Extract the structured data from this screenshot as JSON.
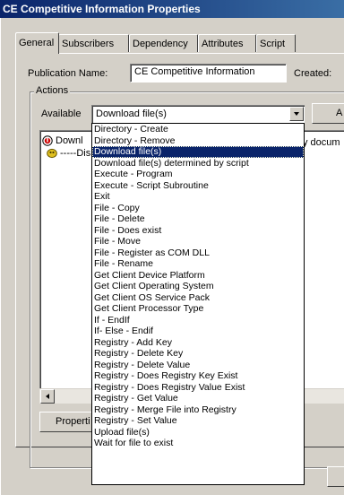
{
  "window": {
    "title": "CE Competitive Information Properties"
  },
  "tabs": [
    {
      "label": "General",
      "active": true
    },
    {
      "label": "Subscribers",
      "active": false
    },
    {
      "label": "Dependency",
      "active": false
    },
    {
      "label": "Attributes",
      "active": false
    },
    {
      "label": "Script",
      "active": false
    }
  ],
  "general": {
    "publication_name_label": "Publication Name:",
    "publication_name_value": "CE Competitive Information",
    "created_label": "Created:",
    "actions_group_label": "Actions",
    "available_label": "Available",
    "available_selected": "Download file(s)",
    "add_button_partial": "A",
    "properties_button_partial": "Properti",
    "right_edge_text": "y docum"
  },
  "action_tree": [
    {
      "text": "Downl",
      "icon": "download-action-icon",
      "icon_color": "#cc0000"
    },
    {
      "text": "-----Dis",
      "icon": "script-action-icon",
      "icon_color": "#d8b000"
    }
  ],
  "dropdown_options": [
    "Directory - Create",
    "Directory - Remove",
    "Download file(s)",
    "Download file(s) determined by script",
    "Execute - Program",
    "Execute - Script Subroutine",
    "Exit",
    "File - Copy",
    "File - Delete",
    "File - Does exist",
    "File - Move",
    "File - Register as COM DLL",
    "File - Rename",
    "Get Client Device Platform",
    "Get Client Operating System",
    "Get Client OS Service Pack",
    "Get Client Processor Type",
    "If - EndIf",
    "If- Else - Endif",
    "Registry - Add Key",
    "Registry - Delete Key",
    "Registry - Delete Value",
    "Registry - Does Registry Key Exist",
    "Registry - Does Registry Value Exist",
    "Registry - Get Value",
    "Registry - Merge File into Registry",
    "Registry - Set Value",
    "Upload file(s)",
    "Wait for file to exist"
  ],
  "dropdown_selected_index": 2,
  "colors": {
    "title_bar": "#0a246a",
    "selection": "#0a246a",
    "face": "#d4d0c8"
  }
}
